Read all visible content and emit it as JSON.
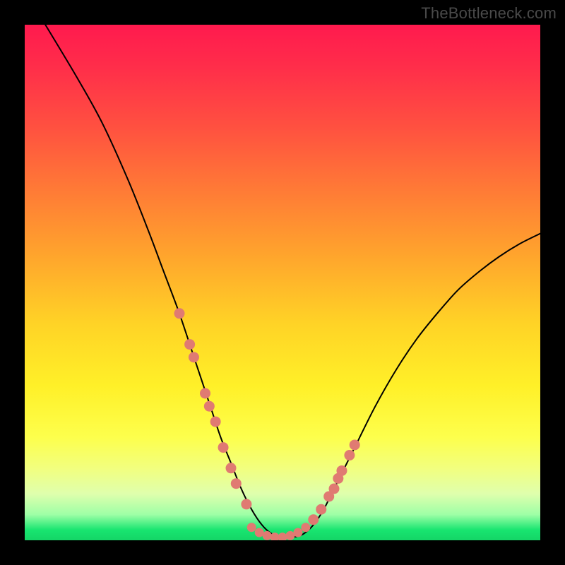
{
  "watermark": "TheBottleneck.com",
  "chart_data": {
    "type": "line",
    "title": "",
    "xlabel": "",
    "ylabel": "",
    "xlim": [
      0,
      100
    ],
    "ylim": [
      0,
      100
    ],
    "grid": false,
    "legend": false,
    "series": [
      {
        "name": "curve",
        "x": [
          4,
          10,
          15,
          20,
          24,
          27,
          30,
          33,
          36,
          38,
          40,
          42,
          44,
          46,
          48,
          50,
          52,
          54,
          56,
          58,
          60,
          64,
          68,
          72,
          76,
          80,
          84,
          88,
          92,
          96,
          100
        ],
        "y": [
          100,
          90,
          81,
          70,
          60,
          52,
          44,
          35,
          26,
          20,
          15,
          10,
          6,
          3,
          1.2,
          0.6,
          0.6,
          1.2,
          3,
          6,
          10,
          18,
          26,
          33,
          39,
          44,
          48.5,
          52,
          55,
          57.5,
          59.5
        ]
      }
    ],
    "markers_left": {
      "name": "dots-left",
      "color": "#e07a72",
      "x": [
        30,
        32,
        32.8,
        35,
        35.8,
        37,
        38.5,
        40,
        41,
        43
      ],
      "y": [
        44,
        38,
        35.5,
        28.5,
        26,
        23,
        18,
        14,
        11,
        7
      ]
    },
    "markers_right": {
      "name": "dots-right",
      "color": "#e07a72",
      "x": [
        56,
        57.5,
        59,
        60,
        60.8,
        61.5,
        63,
        64
      ],
      "y": [
        4,
        6,
        8.5,
        10,
        12,
        13.5,
        16.5,
        18.5
      ]
    },
    "markers_bottom": {
      "name": "dots-bottom",
      "color": "#e07a72",
      "x": [
        44,
        45.5,
        47,
        48.5,
        50,
        51.5,
        53,
        54.5
      ],
      "y": [
        2.5,
        1.5,
        0.9,
        0.6,
        0.6,
        0.9,
        1.5,
        2.5
      ]
    }
  }
}
